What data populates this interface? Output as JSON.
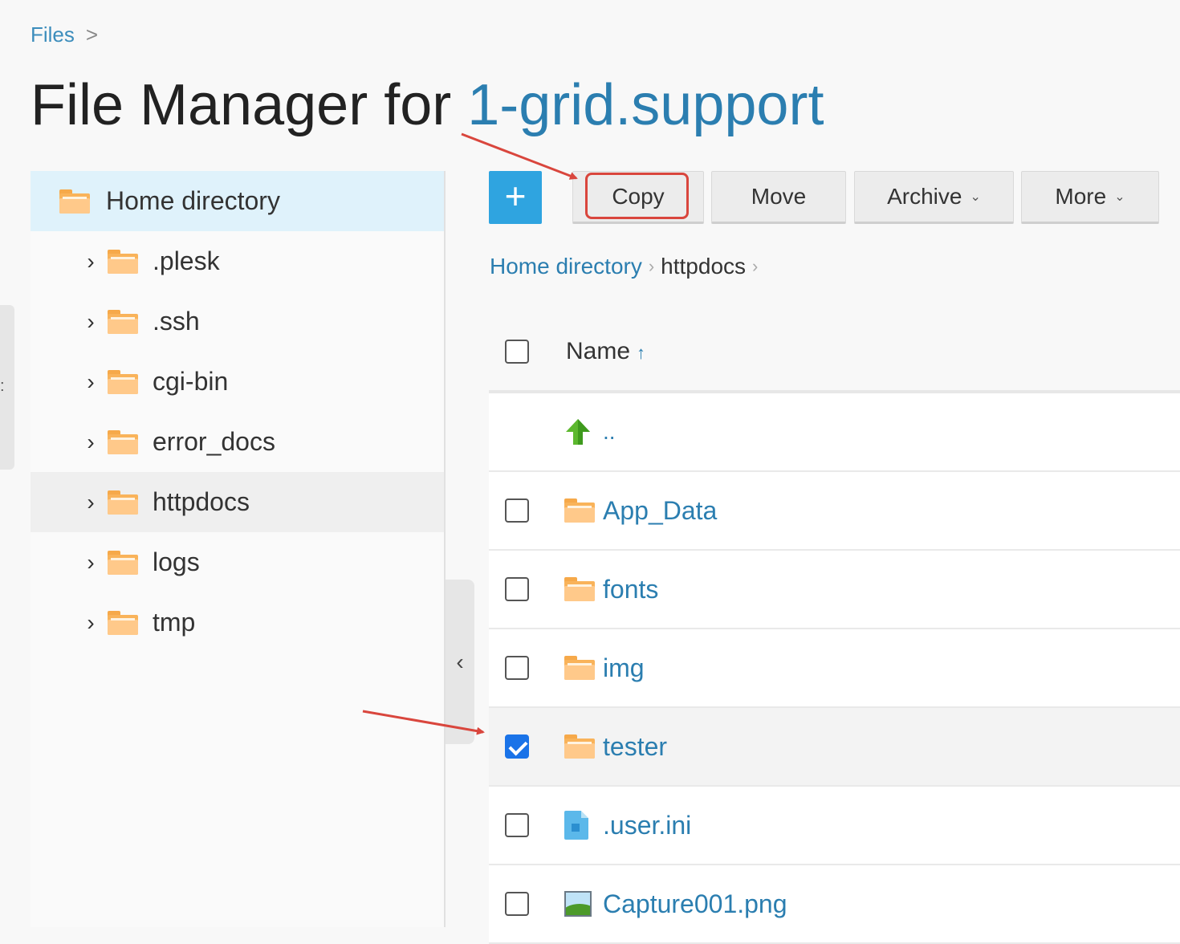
{
  "breadcrumb_top": {
    "label": "Files",
    "chevron": ">"
  },
  "title": {
    "prefix": "File Manager for ",
    "domain": "1-grid.support"
  },
  "tree": {
    "root": {
      "label": "Home directory",
      "icon": "folder-icon"
    },
    "items": [
      {
        "label": ".plesk"
      },
      {
        "label": ".ssh"
      },
      {
        "label": "cgi-bin"
      },
      {
        "label": "error_docs"
      },
      {
        "label": "httpdocs",
        "active": true
      },
      {
        "label": "logs"
      },
      {
        "label": "tmp"
      }
    ]
  },
  "toolbar": {
    "add_label": "+",
    "copy_label": "Copy",
    "move_label": "Move",
    "archive_label": "Archive",
    "more_label": "More"
  },
  "path": {
    "home": "Home directory",
    "current": "httpdocs"
  },
  "list": {
    "header_name": "Name",
    "sort_indicator": "↑",
    "up_label": "..",
    "rows": [
      {
        "name": "App_Data",
        "type": "folder",
        "checked": false
      },
      {
        "name": "fonts",
        "type": "folder",
        "checked": false
      },
      {
        "name": "img",
        "type": "folder",
        "checked": false
      },
      {
        "name": "tester",
        "type": "folder",
        "checked": true
      },
      {
        "name": ".user.ini",
        "type": "file",
        "checked": false
      },
      {
        "name": "Capture001.png",
        "type": "image",
        "checked": false
      }
    ]
  },
  "colors": {
    "accent": "#2b7eb0",
    "primary_button": "#2fa4e0",
    "highlight": "#d9463d",
    "checkbox_checked": "#1a73e8"
  }
}
